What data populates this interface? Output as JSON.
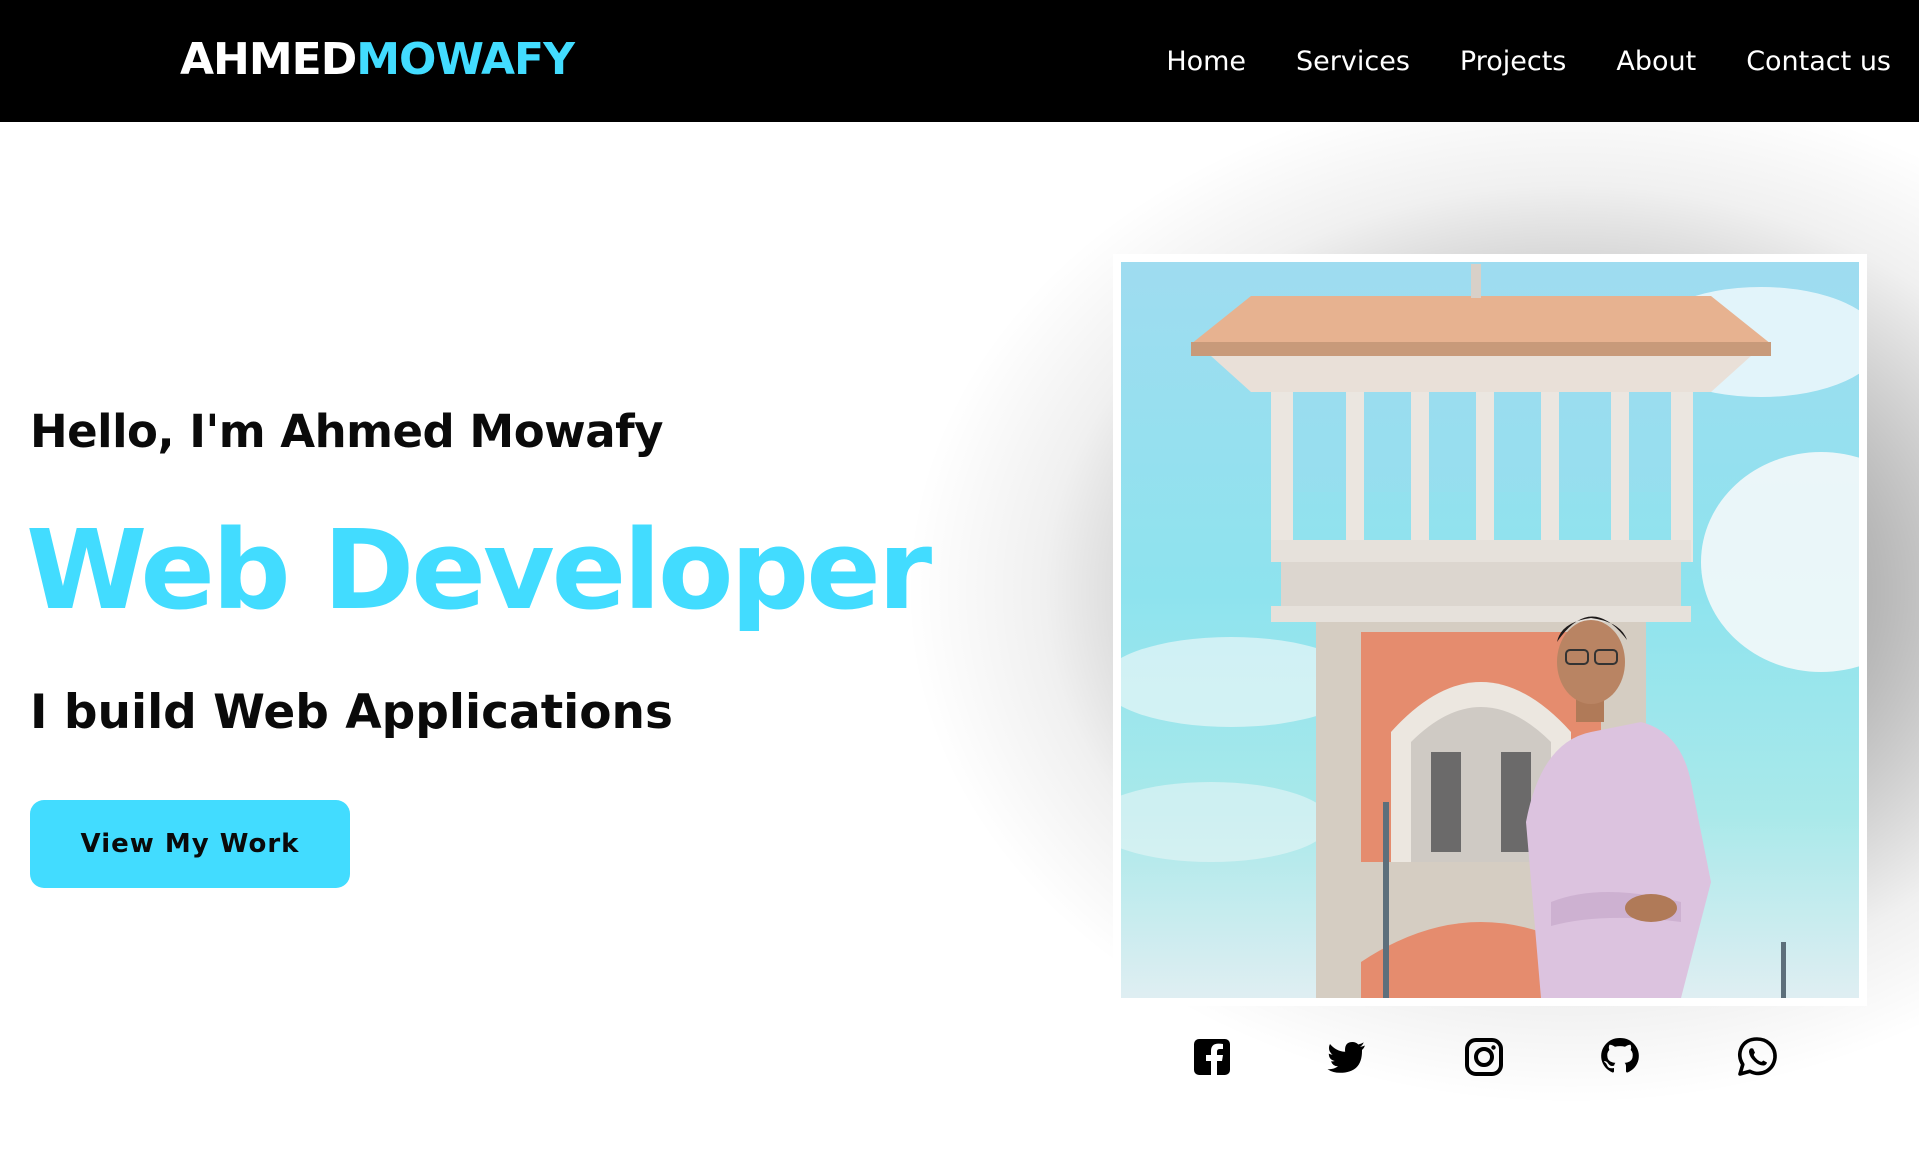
{
  "navbar": {
    "logo_first": "AHMED",
    "logo_last": "MOWAFY",
    "links": [
      "Home",
      "Services",
      "Projects",
      "About",
      "Contact us"
    ]
  },
  "hero": {
    "greeting": "Hello, I'm Ahmed Mowafy",
    "role": "Web Developer",
    "tagline": "I build Web Applications",
    "cta_label": "View My Work"
  },
  "photo": {
    "subject": "portrait-photo"
  },
  "socials": [
    {
      "icon": "facebook-icon"
    },
    {
      "icon": "twitter-icon"
    },
    {
      "icon": "instagram-icon"
    },
    {
      "icon": "github-icon"
    },
    {
      "icon": "whatsapp-icon"
    }
  ],
  "colors": {
    "accent": "#42dcff",
    "navbar_bg": "#000000",
    "text": "#0a0a0a"
  }
}
